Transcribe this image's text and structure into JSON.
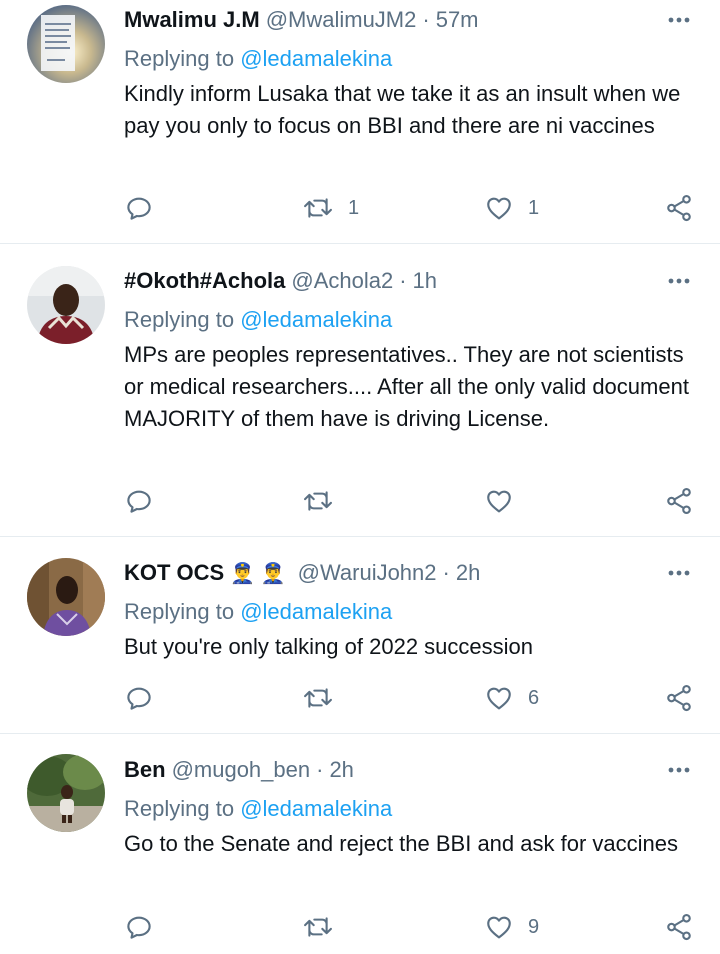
{
  "colors": {
    "accent": "#1da1f2",
    "secondary_text": "#5b7083",
    "icon": "#5b7083",
    "separator": "#e6ecf0"
  },
  "replies": [
    {
      "name": "Mwalimu J.M",
      "badges": "",
      "handle": "@MwalimuJM2",
      "time": "57m",
      "replying_prefix": "Replying to",
      "replying_to": "@ledamalekina",
      "text": "Kindly inform Lusaka that we take it as an insult when we pay you only to focus on BBI and there are ni vaccines",
      "retweets": "1",
      "likes": "1"
    },
    {
      "name": "#Okoth#Achola",
      "badges": "",
      "handle": "@Achola2",
      "time": "1h",
      "replying_prefix": "Replying to",
      "replying_to": "@ledamalekina",
      "text": "MPs are peoples representatives.. They are not scientists or medical researchers.... After all the only valid document MAJORITY of them have is driving License.",
      "retweets": "",
      "likes": ""
    },
    {
      "name": "KOT OCS",
      "badges": "👮‍♂️ 👮‍♂️",
      "handle": "@WaruiJohn2",
      "time": "2h",
      "replying_prefix": "Replying to",
      "replying_to": "@ledamalekina",
      "text": "But you're only talking of 2022 succession",
      "retweets": "",
      "likes": "6"
    },
    {
      "name": "Ben",
      "badges": "",
      "handle": "@mugoh_ben",
      "time": "2h",
      "replying_prefix": "Replying to",
      "replying_to": "@ledamalekina",
      "text": "Go to the Senate and reject the BBI and ask for vaccines",
      "retweets": "",
      "likes": "9"
    }
  ]
}
